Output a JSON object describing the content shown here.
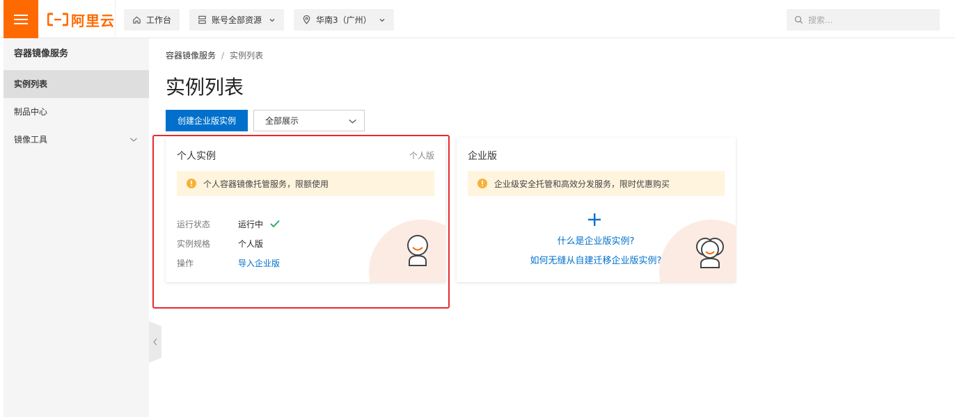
{
  "topbar": {
    "logo_text": "阿里云",
    "workbench_label": "工作台",
    "resources_label": "账号全部资源",
    "region_label": "华南3（广州）",
    "search_placeholder": "搜索..."
  },
  "sidebar": {
    "title": "容器镜像服务",
    "items": [
      {
        "label": "实例列表",
        "active": true
      },
      {
        "label": "制品中心",
        "active": false
      },
      {
        "label": "镜像工具",
        "active": false,
        "expandable": true
      }
    ]
  },
  "breadcrumb": {
    "root": "容器镜像服务",
    "separator": "/",
    "current": "实例列表"
  },
  "page": {
    "title": "实例列表",
    "create_button": "创建企业版实例",
    "filter_value": "全部展示"
  },
  "personal_card": {
    "title": "个人实例",
    "tag": "个人版",
    "notice": "个人容器镜像托管服务，限额使用",
    "status_key": "运行状态",
    "status_value": "运行中",
    "spec_key": "实例规格",
    "spec_value": "个人版",
    "action_key": "操作",
    "action_link": "导入企业版"
  },
  "enterprise_card": {
    "title": "企业版",
    "notice": "企业级安全托管和高效分发服务，限时优惠购买",
    "link_what": "什么是企业版实例?",
    "link_migrate": "如何无缝从自建迁移企业版实例?"
  },
  "colors": {
    "brand": "#ff6a00",
    "primary": "#0070cc",
    "success": "#23a55a",
    "warning_icon": "#f5b23a",
    "highlight": "#e52a2a"
  }
}
